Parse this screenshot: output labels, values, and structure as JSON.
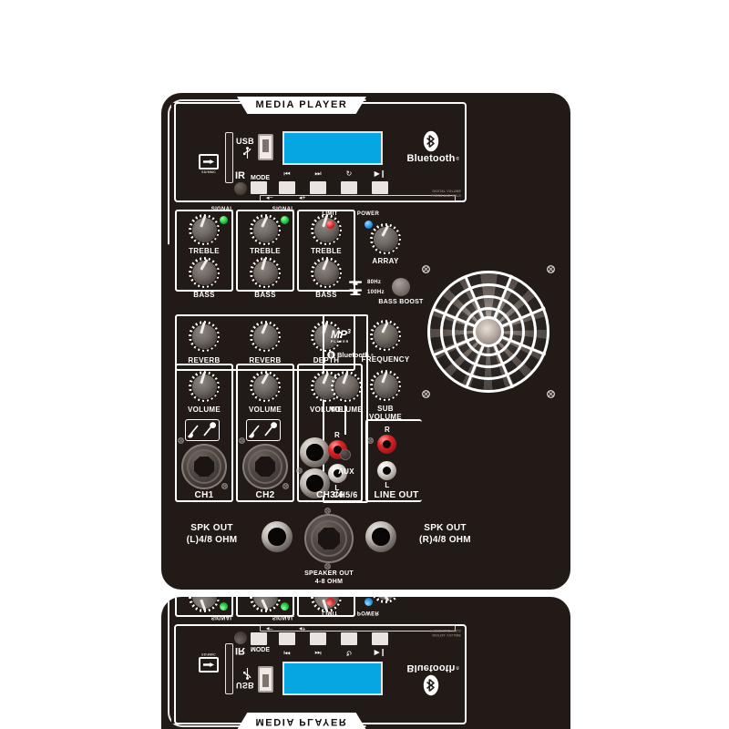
{
  "device": {
    "type": "powered-speaker-amplifier-panel",
    "panel_color": "#221a16",
    "accent_color": "#ffffff",
    "lcd_color": "#05a6e2",
    "led_colors": {
      "signal": "#0fbf37",
      "limit": "#e01f23",
      "power": "#1a8fe0"
    }
  },
  "media_player": {
    "banner": "MEDIA PLAYER",
    "sd_slot_caption": "SD/MMC",
    "usb_label": "USB",
    "ir_label": "IR",
    "mode_label": "MODE",
    "bluetooth_word": "Bluetooth",
    "bluetooth_mark": "®",
    "transport_buttons": [
      {
        "name": "prev",
        "glyph": "⏮"
      },
      {
        "name": "next",
        "glyph": "⏭"
      },
      {
        "name": "repeat",
        "glyph": "↻"
      },
      {
        "name": "play-pause",
        "glyph": "▶❙"
      }
    ],
    "volume_minus": "◂−",
    "volume_plus": "◂+",
    "digital_volume_note_line1": "DIGITAL  VOLUME",
    "digital_volume_note_line2": "PRESS  AND  HOLD"
  },
  "status_leds": [
    {
      "label": "SIGNAL",
      "color": "green"
    },
    {
      "label": "SIGNAL",
      "color": "green"
    },
    {
      "label": "LIMIT",
      "color": "red"
    },
    {
      "label": "POWER",
      "color": "blue"
    }
  ],
  "eq_strips": [
    {
      "treble": "TREBLE",
      "bass": "BASS",
      "signal": "SIGNAL"
    },
    {
      "treble": "TREBLE",
      "bass": "BASS",
      "signal": "SIGNAL"
    },
    {
      "treble": "TREBLE",
      "bass": "BASS",
      "signal": ""
    }
  ],
  "effect_knobs": [
    {
      "label": "REVERB"
    },
    {
      "label": "REVERB"
    },
    {
      "label": "DEPTH"
    }
  ],
  "volume_knobs": [
    {
      "label": "VOLUME"
    },
    {
      "label": "VOLUME"
    },
    {
      "label": "VOLUME"
    },
    {
      "label": "VOLUME"
    }
  ],
  "right_controls": {
    "array": "ARRAY",
    "bass_boost": "BASS BOOST",
    "freq_low": "80Hz",
    "freq_high": "100Hz",
    "frequency": "FREQUENCY",
    "sub_volume_line1": "SUB",
    "sub_volume_line2": "VOLUME"
  },
  "logos": {
    "mp3_main": "MP",
    "mp3_sup": "3",
    "mp3_sub": "PLAYER",
    "bluetooth": "Bluetooth",
    "bluetooth_mark": "®"
  },
  "channels": [
    {
      "label": "CH1",
      "icon": "guitar-mic-icon"
    },
    {
      "label": "CH2",
      "icon": "guitar-mic-icon"
    },
    {
      "label": "CH3/4",
      "rca_r": "R",
      "rca_l": "L"
    },
    {
      "label": "CH5/6",
      "aux": "AUX"
    },
    {
      "label": "LINE OUT",
      "rca_r": "R",
      "rca_l": "L"
    }
  ],
  "speaker_outputs": {
    "left_line1": "SPK OUT",
    "left_line2": "(L)4/8 OHM",
    "right_line1": "SPK OUT",
    "right_line2": "(R)4/8 OHM",
    "center_line1": "SPEAKER OUT",
    "center_line2": "4-8 OHM"
  }
}
